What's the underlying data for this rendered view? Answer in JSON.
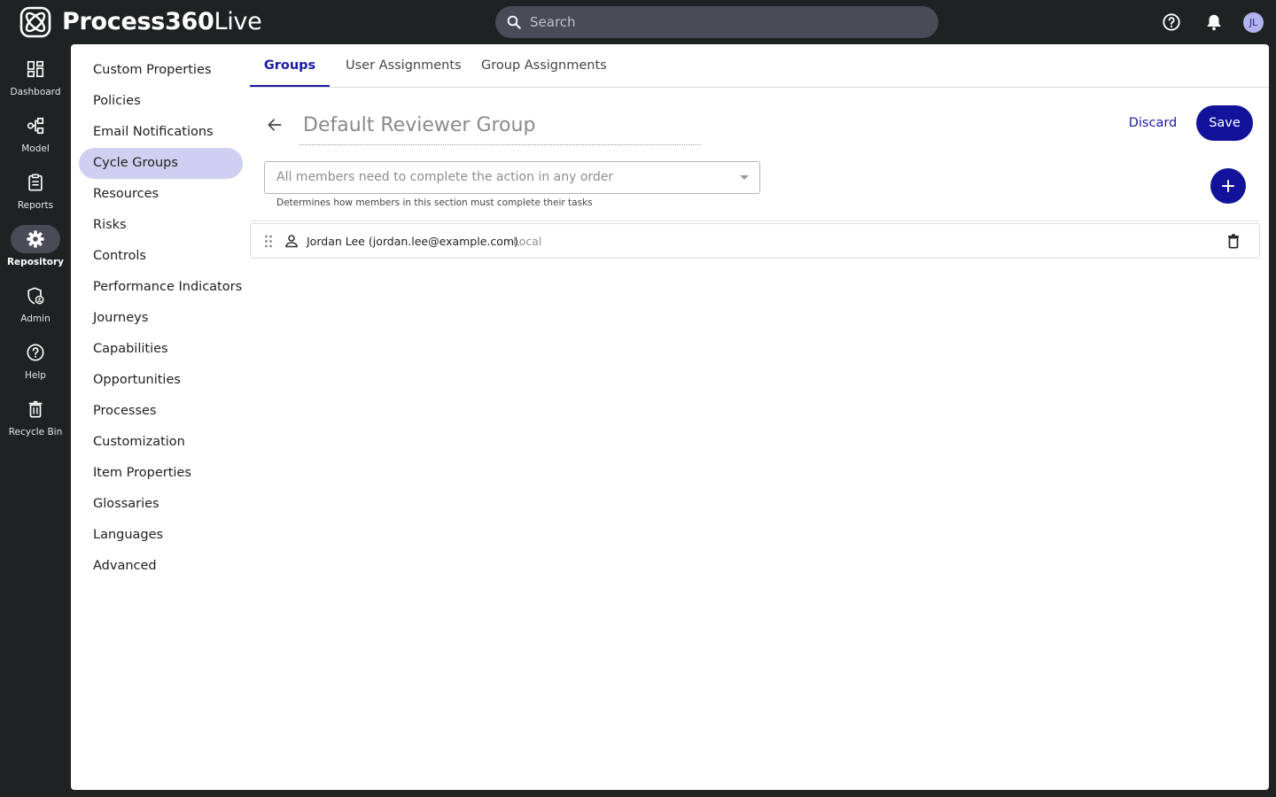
{
  "app": {
    "brand_bold": "Process360",
    "brand_light": "Live"
  },
  "search": {
    "placeholder": "Search"
  },
  "user": {
    "initials": "JL"
  },
  "leftnav": {
    "items": [
      {
        "label": "Dashboard",
        "icon": "dashboard-icon"
      },
      {
        "label": "Model",
        "icon": "model-icon"
      },
      {
        "label": "Reports",
        "icon": "reports-icon"
      },
      {
        "label": "Repository",
        "icon": "gear-icon",
        "active": true
      },
      {
        "label": "Admin",
        "icon": "admin-shield-icon"
      },
      {
        "label": "Help",
        "icon": "help-icon"
      },
      {
        "label": "Recycle Bin",
        "icon": "trash-icon"
      }
    ]
  },
  "sidemenu": {
    "items": [
      "Custom Properties",
      "Policies",
      "Email Notifications",
      "Cycle Groups",
      "Resources",
      "Risks",
      "Controls",
      "Performance Indicators",
      "Journeys",
      "Capabilities",
      "Opportunities",
      "Processes",
      "Customization",
      "Item Properties",
      "Glossaries",
      "Languages",
      "Advanced"
    ],
    "active": "Cycle Groups"
  },
  "tabs": {
    "items": [
      "Groups",
      "User Assignments",
      "Group Assignments"
    ],
    "active": "Groups"
  },
  "editor": {
    "group_name_placeholder": "Default Reviewer Group",
    "discard_label": "Discard",
    "save_label": "Save",
    "completion_mode": "All members need to complete the action in any order",
    "completion_helper": "Determines how members in this section must complete their tasks"
  },
  "members": [
    {
      "name": "Jordan Lee (jordan.lee@example.com)",
      "separator": "·",
      "source": "Local"
    }
  ],
  "colors": {
    "accent": "#12129a",
    "active_menu_bg": "#cfd0f1",
    "topbar_bg": "#1f2223",
    "search_bg": "#4a4b57"
  }
}
